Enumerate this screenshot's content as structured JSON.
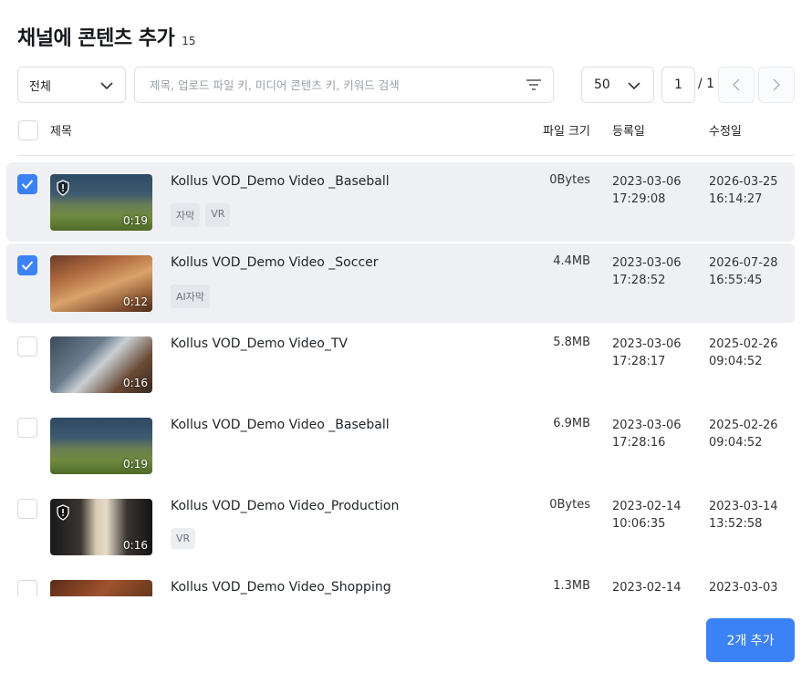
{
  "header": {
    "title": "채널에 콘텐츠 추가",
    "count": "15"
  },
  "toolbar": {
    "filter_select": "전체",
    "search_placeholder": "제목, 업로드 파일 키, 미디어 콘텐츠 키, 키워드 검색",
    "per_page": "50",
    "page": "1",
    "page_total": "/ 1"
  },
  "table": {
    "headers": {
      "title": "제목",
      "size": "파일 크기",
      "registered": "등록일",
      "modified": "수정일"
    }
  },
  "rows": [
    {
      "checked": true,
      "title": "Kollus VOD_Demo Video _Baseball",
      "tags": [
        "자막",
        "VR"
      ],
      "size": "0Bytes",
      "reg_date": "2023-03-06",
      "reg_time": "17:29:08",
      "mod_date": "2026-03-25",
      "mod_time": "16:14:27",
      "duration": "0:19",
      "drm": true,
      "thumb": "baseball"
    },
    {
      "checked": true,
      "title": "Kollus VOD_Demo Video _Soccer",
      "tags": [
        "AI자막"
      ],
      "size": "4.4MB",
      "reg_date": "2023-03-06",
      "reg_time": "17:28:52",
      "mod_date": "2026-07-28",
      "mod_time": "16:55:45",
      "duration": "0:12",
      "drm": false,
      "thumb": "soccer"
    },
    {
      "checked": false,
      "title": "Kollus VOD_Demo Video_TV",
      "tags": [],
      "size": "5.8MB",
      "reg_date": "2023-03-06",
      "reg_time": "17:28:17",
      "mod_date": "2025-02-26",
      "mod_time": "09:04:52",
      "duration": "0:16",
      "drm": false,
      "thumb": "tv"
    },
    {
      "checked": false,
      "title": "Kollus VOD_Demo Video _Baseball",
      "tags": [],
      "size": "6.9MB",
      "reg_date": "2023-03-06",
      "reg_time": "17:28:16",
      "mod_date": "2025-02-26",
      "mod_time": "09:04:52",
      "duration": "0:19",
      "drm": false,
      "thumb": "baseball"
    },
    {
      "checked": false,
      "title": "Kollus VOD_Demo Video_Production",
      "tags": [
        "VR"
      ],
      "size": "0Bytes",
      "reg_date": "2023-02-14",
      "reg_time": "10:06:35",
      "mod_date": "2023-03-14",
      "mod_time": "13:52:58",
      "duration": "0:16",
      "drm": true,
      "thumb": "production"
    },
    {
      "checked": false,
      "title": "Kollus VOD_Demo Video_Shopping",
      "tags": [],
      "size": "1.3MB",
      "reg_date": "2023-02-14",
      "reg_time": "",
      "mod_date": "2023-03-03",
      "mod_time": "",
      "duration": "",
      "drm": false,
      "thumb": "shopping"
    }
  ],
  "footer": {
    "add_button": "2개 추가"
  },
  "colors": {
    "accent": "#3b82f6",
    "selected_row": "#eef0f3"
  }
}
